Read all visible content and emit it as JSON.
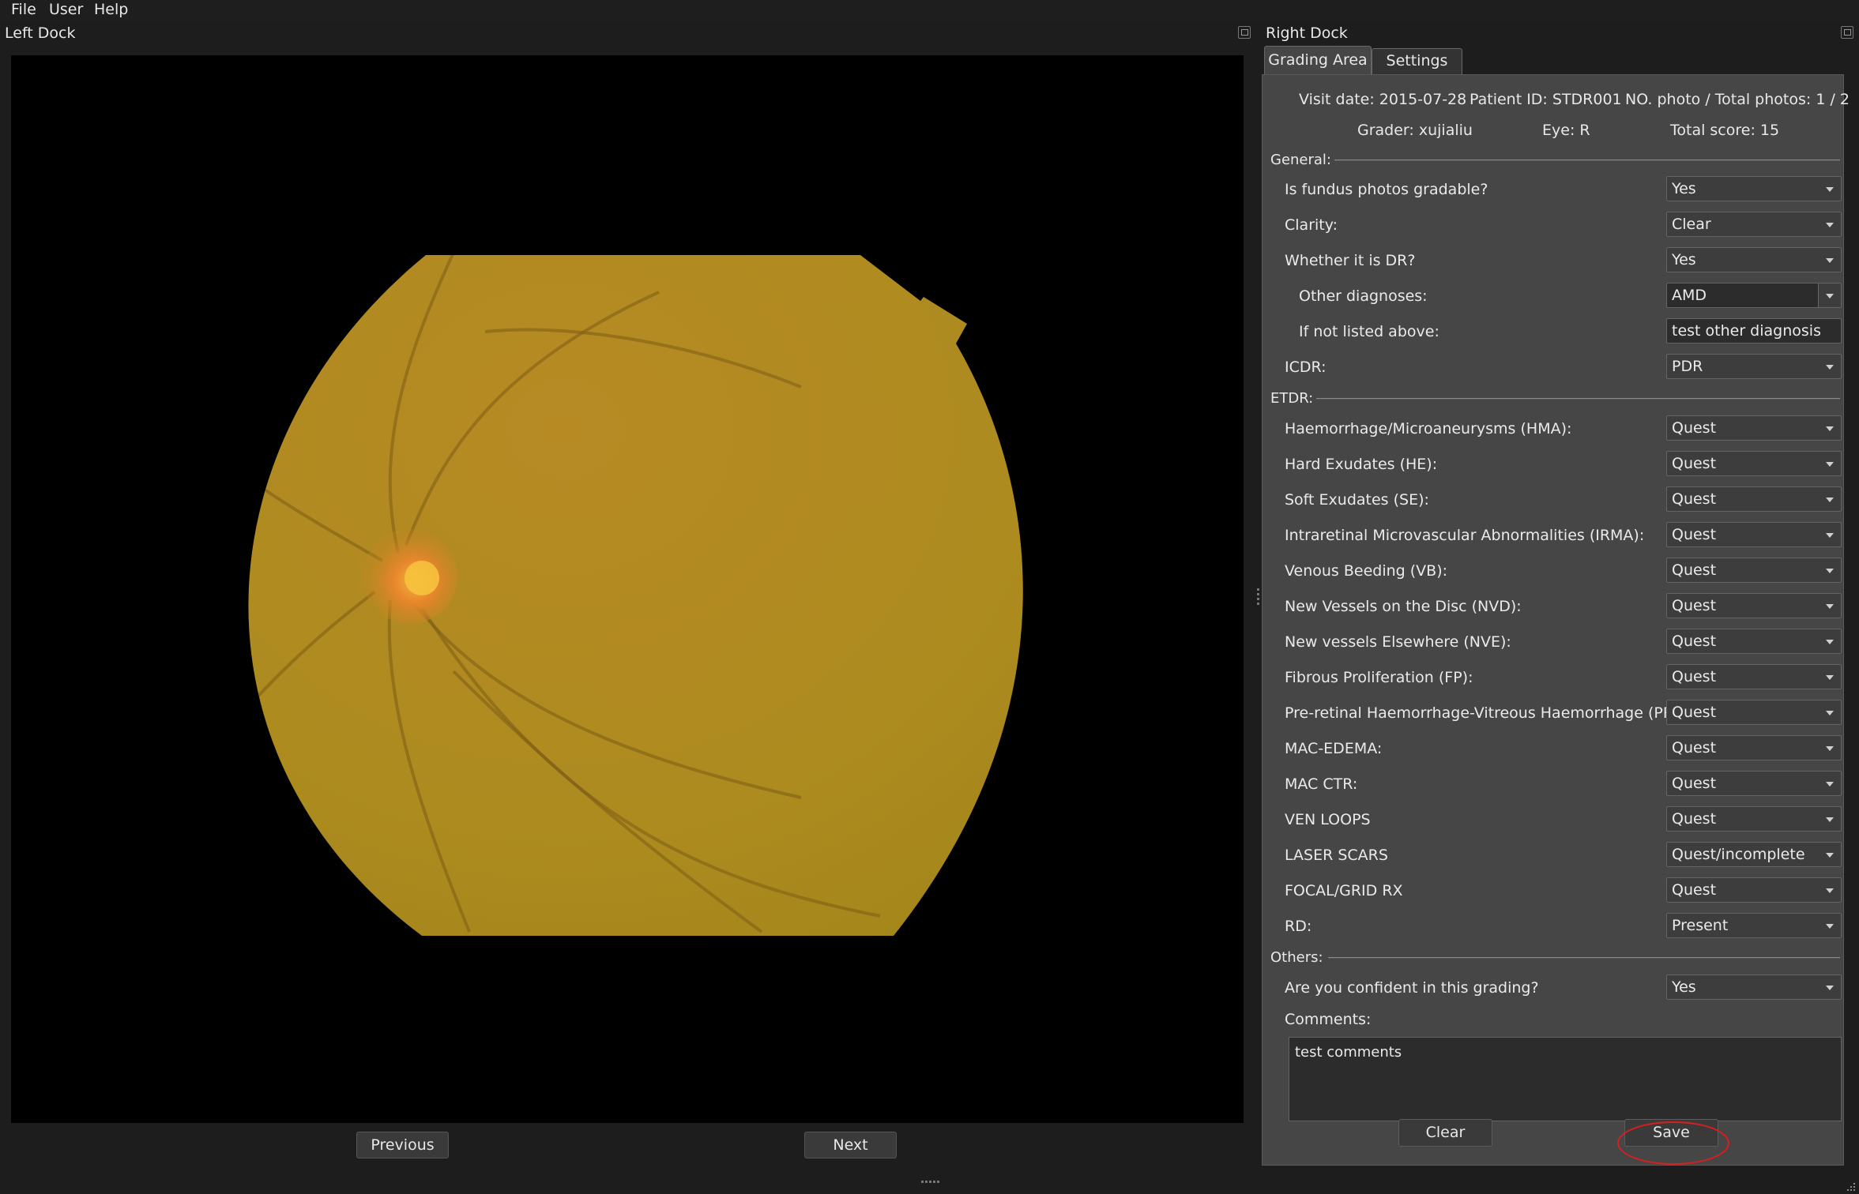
{
  "menu": [
    "File",
    "User",
    "Help"
  ],
  "left_dock": {
    "title": "Left Dock",
    "prev_label": "Previous",
    "next_label": "Next"
  },
  "right_dock": {
    "title": "Right Dock",
    "tabs": [
      "Grading Area",
      "Settings"
    ],
    "active_tab": "Grading Area"
  },
  "grading": {
    "visit_date": "Visit date: 2015-07-28",
    "patient_id": "Patient ID: STDR001",
    "photo_count": "NO. photo / Total photos: 1 / 2",
    "grader": "Grader: xujialiu",
    "eye": "Eye: R",
    "total_score": "Total score: 15",
    "sections": {
      "general": "General:",
      "etdr": "ETDR:",
      "others": "Others:"
    },
    "general_rows": [
      {
        "label": "Is fundus photos gradable?",
        "value": "Yes"
      },
      {
        "label": "Clarity:",
        "value": "Clear"
      },
      {
        "label": "Whether it is DR?",
        "value": "Yes"
      },
      {
        "label": "Other diagnoses:",
        "value": "AMD"
      },
      {
        "label": "If not listed above:",
        "value": "test other diagnosis"
      },
      {
        "label": "ICDR:",
        "value": "PDR"
      }
    ],
    "etdr_rows": [
      {
        "label": "Haemorrhage/Microaneurysms (HMA):",
        "value": "Quest"
      },
      {
        "label": "Hard Exudates (HE):",
        "value": "Quest"
      },
      {
        "label": "Soft Exudates (SE):",
        "value": "Quest"
      },
      {
        "label": "Intraretinal Microvascular Abnormalities (IRMA):",
        "value": "Quest"
      },
      {
        "label": "Venous Beeding (VB):",
        "value": "Quest"
      },
      {
        "label": "New Vessels on the Disc (NVD):",
        "value": "Quest"
      },
      {
        "label": "New vessels Elsewhere (NVE):",
        "value": "Quest"
      },
      {
        "label": "Fibrous Proliferation (FP):",
        "value": "Quest"
      },
      {
        "label": "Pre-retinal Haemorrhage-Vitreous Haemorrhage (PRH-VH):",
        "value": "Quest"
      },
      {
        "label": "MAC-EDEMA:",
        "value": "Quest"
      },
      {
        "label": "MAC CTR:",
        "value": "Quest"
      },
      {
        "label": "VEN LOOPS",
        "value": "Quest"
      },
      {
        "label": "LASER SCARS",
        "value": "Quest/incomplete"
      },
      {
        "label": "FOCAL/GRID RX",
        "value": "Quest"
      },
      {
        "label": "RD:",
        "value": "Present"
      }
    ],
    "others_rows": [
      {
        "label": "Are you confident in this grading?",
        "value": "Yes"
      }
    ],
    "comments_label": "Comments:",
    "comments_value": "test comments",
    "clear_label": "Clear",
    "save_label": "Save"
  },
  "colors": {
    "background": "#1d1d1d",
    "panel": "#464646",
    "fundus": "#b08a1e",
    "highlight": "#d81e1e"
  }
}
